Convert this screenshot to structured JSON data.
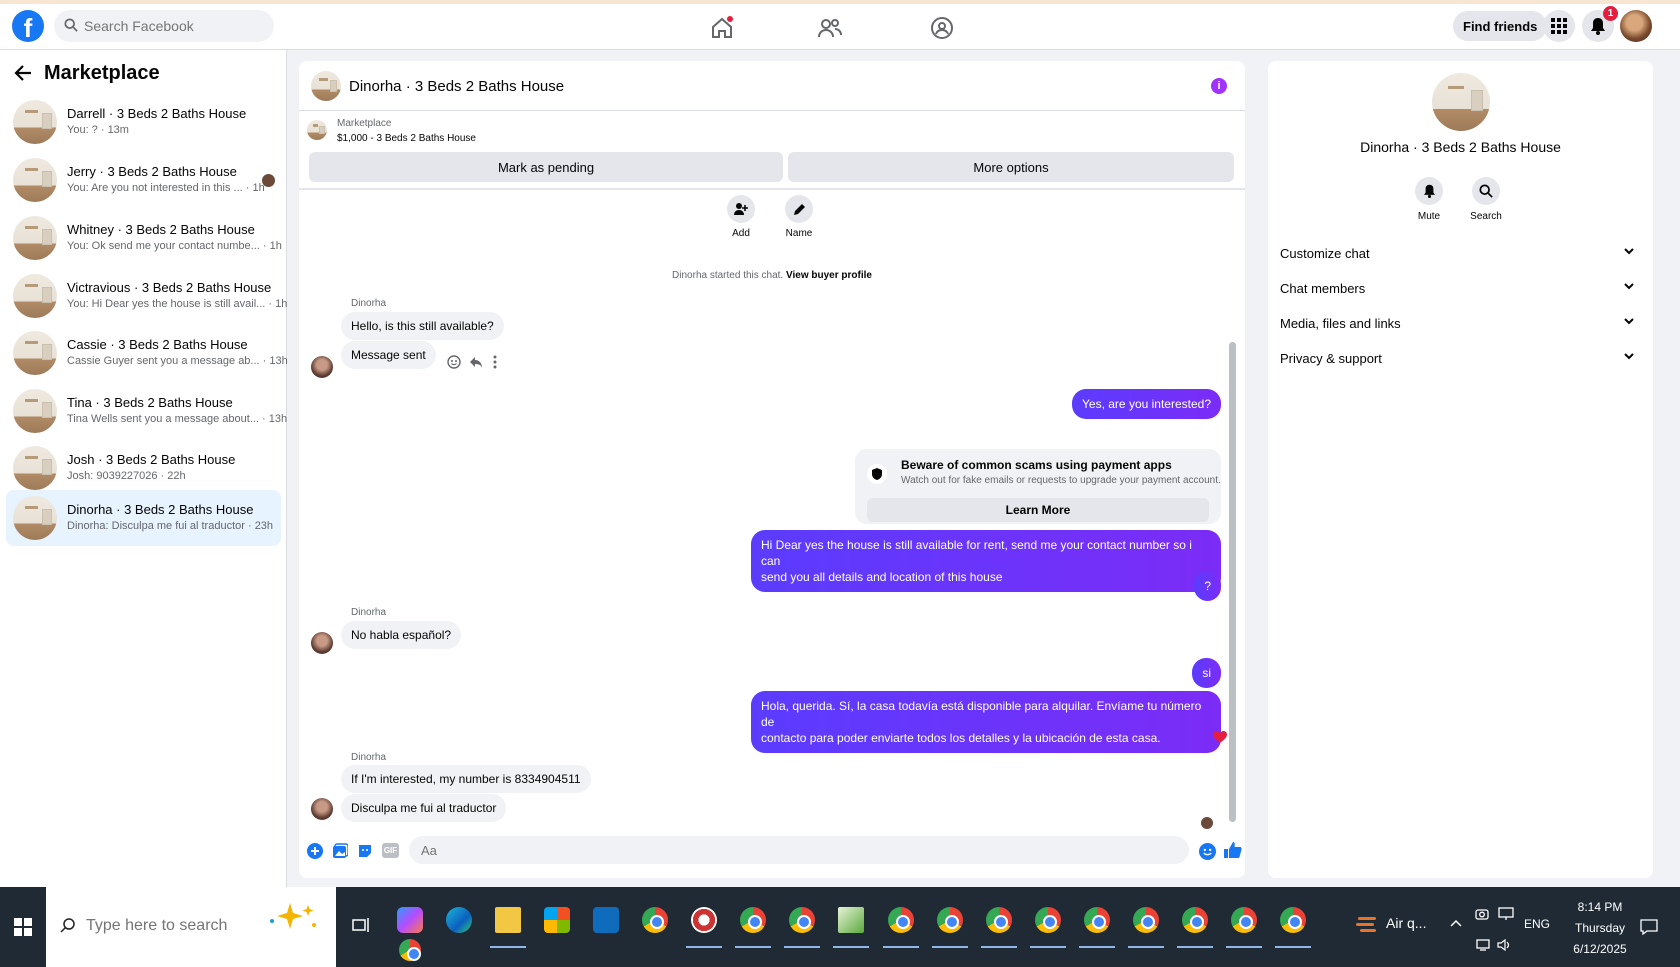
{
  "topbar": {
    "search_placeholder": "Search Facebook",
    "find_friends_label": "Find friends",
    "notification_count": "1",
    "logo_letter": "f"
  },
  "sidebar": {
    "title": "Marketplace",
    "conversations": [
      {
        "name": "Darrell · 3 Beds 2 Baths House",
        "snippet": "You: ? · 13m"
      },
      {
        "name": "Jerry · 3 Beds 2 Baths House",
        "snippet": "You: Are you not interested in this ... · 1h"
      },
      {
        "name": "Whitney · 3 Beds 2 Baths House",
        "snippet": "You: Ok send me your contact numbe... · 1h"
      },
      {
        "name": "Victravious · 3 Beds 2 Baths House",
        "snippet": "You: Hi Dear yes the house is still avail... · 1h"
      },
      {
        "name": "Cassie · 3 Beds 2 Baths House",
        "snippet": "Cassie Guyer sent you a message ab... · 13h"
      },
      {
        "name": "Tina · 3 Beds 2 Baths House",
        "snippet": "Tina Wells sent you a message about... · 13h"
      },
      {
        "name": "Josh · 3 Beds 2 Baths House",
        "snippet": "Josh: 9039227026 · 22h"
      },
      {
        "name": "Dinorha · 3 Beds 2 Baths House",
        "snippet": "Dinorha: Disculpa me fui al traductor · 23h"
      }
    ]
  },
  "chat": {
    "title": "Dinorha · 3 Beds 2 Baths House",
    "marketplace_label": "Marketplace",
    "listing_desc": "$1,000 - 3 Beds 2 Baths House",
    "mark_pending_label": "Mark as pending",
    "more_options_label": "More options",
    "add_label": "Add",
    "name_label": "Name",
    "start_note": "Dinorha started this chat.",
    "view_buyer_profile": "View buyer profile",
    "sender_name": "Dinorha",
    "messages": {
      "m1": "Hello, is this still available?",
      "m2": "Message sent",
      "m3": "Yes, are you interested?",
      "m4_line1": "Hi Dear yes the house is still available for rent, send me your contact number so i can",
      "m4_line2": "send you all details and location of this house",
      "m5": "?",
      "m6": "No habla español?",
      "m7": "si",
      "m8_line1": "Hola, querida. Sí, la casa todavía está disponible para alquilar. Envíame tu número de",
      "m8_line2": "contacto para poder enviarte todos los detalles y la ubicación de esta casa.",
      "m9": "If I'm interested, my number is 8334904511",
      "m10": "Disculpa me fui al traductor"
    },
    "scam_card": {
      "title": "Beware of common scams using payment apps",
      "desc": "Watch out for fake emails or requests to upgrade your payment account.",
      "button": "Learn More"
    },
    "composer_placeholder": "Aa",
    "gif_label": "GIF"
  },
  "info_panel": {
    "name": "Dinorha · 3 Beds 2 Baths House",
    "mute_label": "Mute",
    "search_label": "Search",
    "sections": [
      "Customize chat",
      "Chat members",
      "Media, files and links",
      "Privacy & support"
    ]
  },
  "taskbar": {
    "search_placeholder": "Type here to search",
    "weather": "Air q...",
    "language": "ENG",
    "time": "8:14 PM",
    "day": "Thursday",
    "date": "6/12/2025"
  },
  "colors": {
    "accent": "#1877f2",
    "outgoing_bubble": "#6e3cf0",
    "active_row": "#e7f3ff",
    "notification_red": "#e41e3f"
  }
}
